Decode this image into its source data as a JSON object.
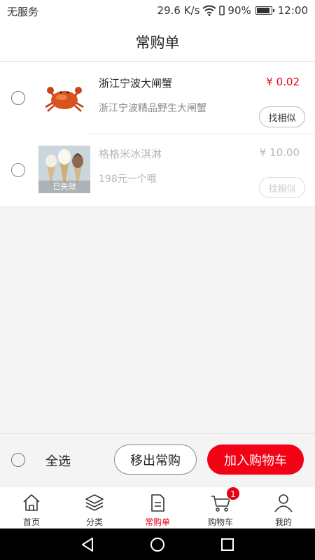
{
  "status_bar": {
    "carrier": "无服务",
    "speed": "29.6 K/s",
    "battery": "90%",
    "time": "12:00"
  },
  "header": {
    "title": "常购单"
  },
  "items": [
    {
      "name": "浙江宁波大闸蟹",
      "desc": "浙江宁波精品野生大闸蟹",
      "price": "¥ 0.02",
      "similar_label": "找相似",
      "image": "crab-image"
    },
    {
      "name": "格格米冰淇淋",
      "desc": "198元一个哦",
      "price": "¥ 10.00",
      "similar_label": "找相似",
      "invalid_label": "已失效",
      "image": "ice-cream-image"
    }
  ],
  "action_bar": {
    "select_all": "全选",
    "remove_label": "移出常购",
    "add_label": "加入购物车"
  },
  "tabs": [
    {
      "label": "首页",
      "icon": "home-icon"
    },
    {
      "label": "分类",
      "icon": "layers-icon"
    },
    {
      "label": "常购单",
      "icon": "list-icon",
      "active": true
    },
    {
      "label": "购物车",
      "icon": "cart-icon",
      "badge": "1"
    },
    {
      "label": "我的",
      "icon": "user-icon"
    }
  ],
  "colors": {
    "accent": "#e60012",
    "button_red": "#f10215"
  }
}
